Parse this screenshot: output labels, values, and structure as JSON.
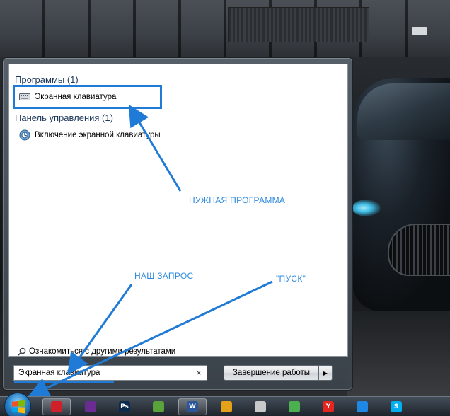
{
  "start_menu": {
    "groups": [
      {
        "header": "Программы (1)",
        "items": [
          {
            "label": "Экранная клавиатура",
            "icon": "keyboard-icon"
          }
        ]
      },
      {
        "header": "Панель управления (1)",
        "items": [
          {
            "label": "Включение экранной клавиатуры",
            "icon": "control-panel-icon"
          }
        ]
      }
    ],
    "more_results": "Ознакомиться с другими результатами",
    "search": {
      "value": "Экранная клавиатура",
      "clear": "×"
    },
    "shutdown": {
      "label": "Завершение работы",
      "arrow": "▶"
    }
  },
  "annotations": {
    "needed_program": "НУЖНАЯ ПРОГРАММА",
    "our_query": "НАШ ЗАПРОС",
    "start": "\"ПУСК\""
  },
  "taskbar": {
    "items": [
      {
        "name": "opera",
        "glyph": "",
        "color": "#d0212b",
        "active": true
      },
      {
        "name": "visual-studio",
        "glyph": "",
        "color": "#6a2c91",
        "active": false
      },
      {
        "name": "photoshop",
        "glyph": "Ps",
        "color": "#0c2a4d",
        "active": false
      },
      {
        "name": "utorrent",
        "glyph": "",
        "color": "#5aa23a",
        "active": false
      },
      {
        "name": "word",
        "glyph": "W",
        "color": "#2b579a",
        "active": true
      },
      {
        "name": "app-warning",
        "glyph": "",
        "color": "#e3a21a",
        "active": false
      },
      {
        "name": "app-misc",
        "glyph": "",
        "color": "#c9c9c9",
        "active": false
      },
      {
        "name": "app-globe",
        "glyph": "",
        "color": "#4caf50",
        "active": false
      },
      {
        "name": "yandex",
        "glyph": "Y",
        "color": "#e52620",
        "active": false
      },
      {
        "name": "chrome",
        "glyph": "",
        "color": "#1e88e5",
        "active": false
      },
      {
        "name": "skype",
        "glyph": "S",
        "color": "#00aff0",
        "active": false
      }
    ]
  }
}
